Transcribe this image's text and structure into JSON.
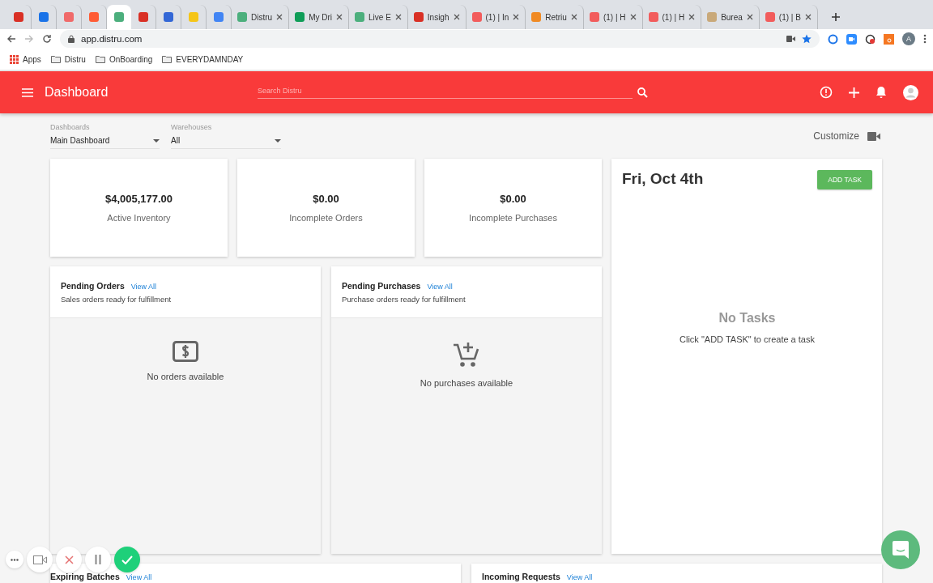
{
  "browser": {
    "tabs": [
      {
        "color": "#d93025",
        "selected": false
      },
      {
        "color": "#1a73e8",
        "selected": false
      },
      {
        "color": "#f06a6a",
        "selected": false
      },
      {
        "color": "#ff5c35",
        "selected": false
      },
      {
        "color": "#4caf7d",
        "selected": true
      },
      {
        "color": "#d93025",
        "selected": false
      },
      {
        "color": "#3367d6",
        "selected": false
      },
      {
        "color": "#f5c518",
        "selected": false
      },
      {
        "color": "#4285f4",
        "selected": false
      },
      {
        "title": "Distru",
        "color": "#4caf7d",
        "selected": false
      },
      {
        "title": "My Dri",
        "color": "#0f9d58",
        "selected": false
      },
      {
        "title": "Live E",
        "color": "#4caf7d",
        "selected": false
      },
      {
        "title": "Insigh",
        "color": "#d93025",
        "selected": false
      },
      {
        "title": "(1) | In",
        "color": "#f25c5c",
        "selected": false
      },
      {
        "title": "Retriu",
        "color": "#f08a24",
        "selected": false
      },
      {
        "title": "(1) | H",
        "color": "#f25c5c",
        "selected": false
      },
      {
        "title": "(1) | H",
        "color": "#f25c5c",
        "selected": false
      },
      {
        "title": "Burea",
        "color": "#c9a97a",
        "selected": false
      },
      {
        "title": "(1) | B",
        "color": "#f25c5c",
        "selected": false
      }
    ],
    "url": "app.distru.com",
    "bookmarks": [
      {
        "label": "Apps",
        "kind": "apps"
      },
      {
        "label": "Distru",
        "kind": "folder"
      },
      {
        "label": "OnBoarding",
        "kind": "folder"
      },
      {
        "label": "EVERYDAMNDAY",
        "kind": "folder"
      }
    ],
    "profile_initial": "A"
  },
  "app_bar": {
    "title": "Dashboard",
    "search": {
      "placeholder": "Search Distru"
    }
  },
  "filters": [
    {
      "label": "Dashboards",
      "value": "Main Dashboard"
    },
    {
      "label": "Warehouses",
      "value": "All"
    }
  ],
  "customize": "Customize",
  "stats": [
    {
      "value": "$4,005,177.00",
      "label": "Active Inventory"
    },
    {
      "value": "$0.00",
      "label": "Incomplete Orders"
    },
    {
      "value": "$0.00",
      "label": "Incomplete Purchases"
    }
  ],
  "panels": [
    {
      "title": "Pending Orders",
      "link": "View All",
      "subtitle": "Sales orders ready for fulfillment",
      "empty": "No orders available",
      "kind": "orders"
    },
    {
      "title": "Pending Purchases",
      "link": "View All",
      "subtitle": "Purchase orders ready for fulfillment",
      "empty": "No purchases available",
      "kind": "purchases"
    }
  ],
  "tasks": {
    "date": "Fri, Oct 4th",
    "button": "ADD TASK",
    "empty_title": "No Tasks",
    "empty_text": "Click \"ADD TASK\" to create a task"
  },
  "bottom_panels": [
    {
      "title": "Expiring Batches",
      "link": "View All"
    },
    {
      "title": "Incoming Requests",
      "link": "View All"
    }
  ]
}
